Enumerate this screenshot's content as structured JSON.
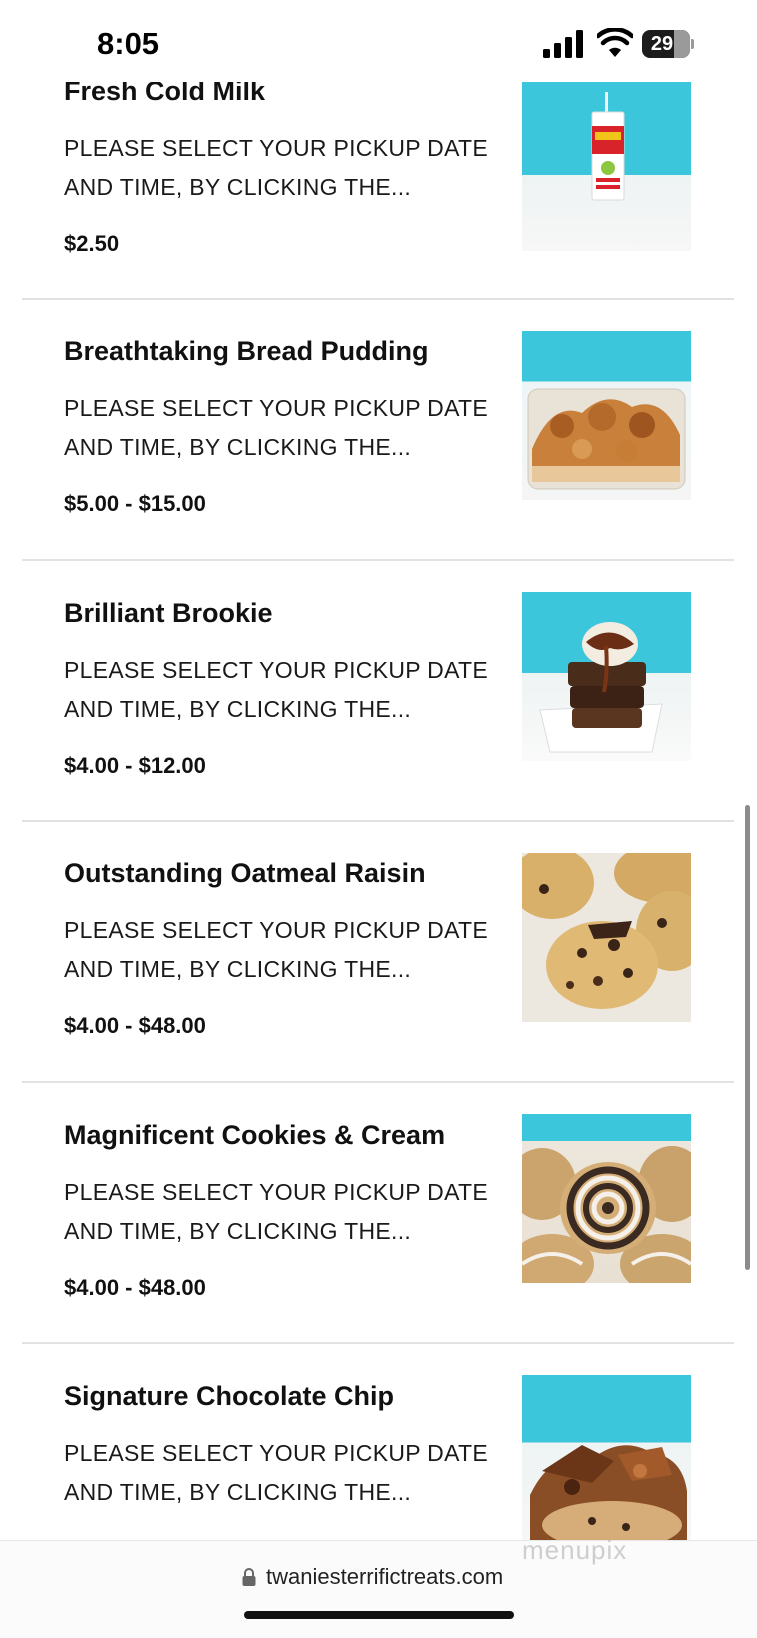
{
  "status_bar": {
    "time": "8:05",
    "battery": "29"
  },
  "menu": {
    "items": [
      {
        "name": "Fresh Cold Milk",
        "description": "PLEASE SELECT YOUR PICKUP DATE AND TIME, BY CLICKING THE...",
        "price": "$2.50",
        "image": "milk-carton-photo"
      },
      {
        "name": "Breathtaking Bread Pudding",
        "description": "PLEASE SELECT YOUR PICKUP DATE AND TIME, BY CLICKING THE...",
        "price": "$5.00 - $15.00",
        "image": "bread-pudding-photo"
      },
      {
        "name": "Brilliant Brookie",
        "description": "PLEASE SELECT YOUR PICKUP DATE AND TIME, BY CLICKING THE...",
        "price": "$4.00 - $12.00",
        "image": "brookie-photo"
      },
      {
        "name": "Outstanding Oatmeal Raisin",
        "description": "PLEASE SELECT YOUR PICKUP DATE AND TIME, BY CLICKING THE...",
        "price": "$4.00 - $48.00",
        "image": "oatmeal-cookie-photo"
      },
      {
        "name": "Magnificent Cookies & Cream",
        "description": "PLEASE SELECT YOUR PICKUP DATE AND TIME, BY CLICKING THE...",
        "price": "$4.00 - $48.00",
        "image": "cookies-cream-photo"
      },
      {
        "name": "Signature Chocolate Chip",
        "description": "PLEASE SELECT YOUR PICKUP DATE AND TIME, BY CLICKING THE...",
        "price": "",
        "image": "chocolate-chip-photo"
      }
    ]
  },
  "browser": {
    "url": "twaniesterrifictreats.com"
  },
  "watermark": "menupix",
  "colors": {
    "photo_background": "#3cc6dc",
    "divider": "#e2e2e2"
  }
}
